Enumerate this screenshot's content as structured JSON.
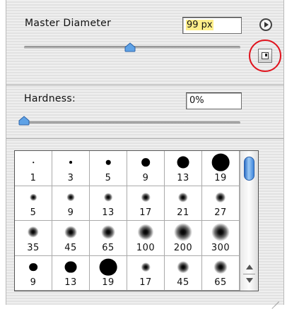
{
  "master_diameter": {
    "label": "Master Diameter",
    "value": "99 px",
    "slider_fraction": 0.49
  },
  "hardness": {
    "label": "Hardness:",
    "value": "0%",
    "slider_fraction": 0.0
  },
  "menu_button": {
    "icon": "play-triangle-icon"
  },
  "new_preset_button": {
    "icon": "new-preset-icon",
    "highlight_color": "#e0141e"
  },
  "brush_presets": [
    {
      "size": "1",
      "kind": "hard"
    },
    {
      "size": "3",
      "kind": "hard"
    },
    {
      "size": "5",
      "kind": "hard"
    },
    {
      "size": "9",
      "kind": "hard"
    },
    {
      "size": "13",
      "kind": "hard"
    },
    {
      "size": "19",
      "kind": "hard"
    },
    {
      "size": "5",
      "kind": "soft"
    },
    {
      "size": "9",
      "kind": "soft"
    },
    {
      "size": "13",
      "kind": "soft"
    },
    {
      "size": "17",
      "kind": "soft"
    },
    {
      "size": "21",
      "kind": "soft"
    },
    {
      "size": "27",
      "kind": "soft"
    },
    {
      "size": "35",
      "kind": "soft"
    },
    {
      "size": "45",
      "kind": "soft"
    },
    {
      "size": "65",
      "kind": "soft"
    },
    {
      "size": "100",
      "kind": "soft"
    },
    {
      "size": "200",
      "kind": "soft"
    },
    {
      "size": "300",
      "kind": "soft"
    },
    {
      "size": "9",
      "kind": "hard"
    },
    {
      "size": "13",
      "kind": "hard"
    },
    {
      "size": "19",
      "kind": "hard"
    },
    {
      "size": "17",
      "kind": "soft"
    },
    {
      "size": "45",
      "kind": "soft"
    },
    {
      "size": "65",
      "kind": "soft"
    }
  ],
  "accent_color": "#3f86dc"
}
